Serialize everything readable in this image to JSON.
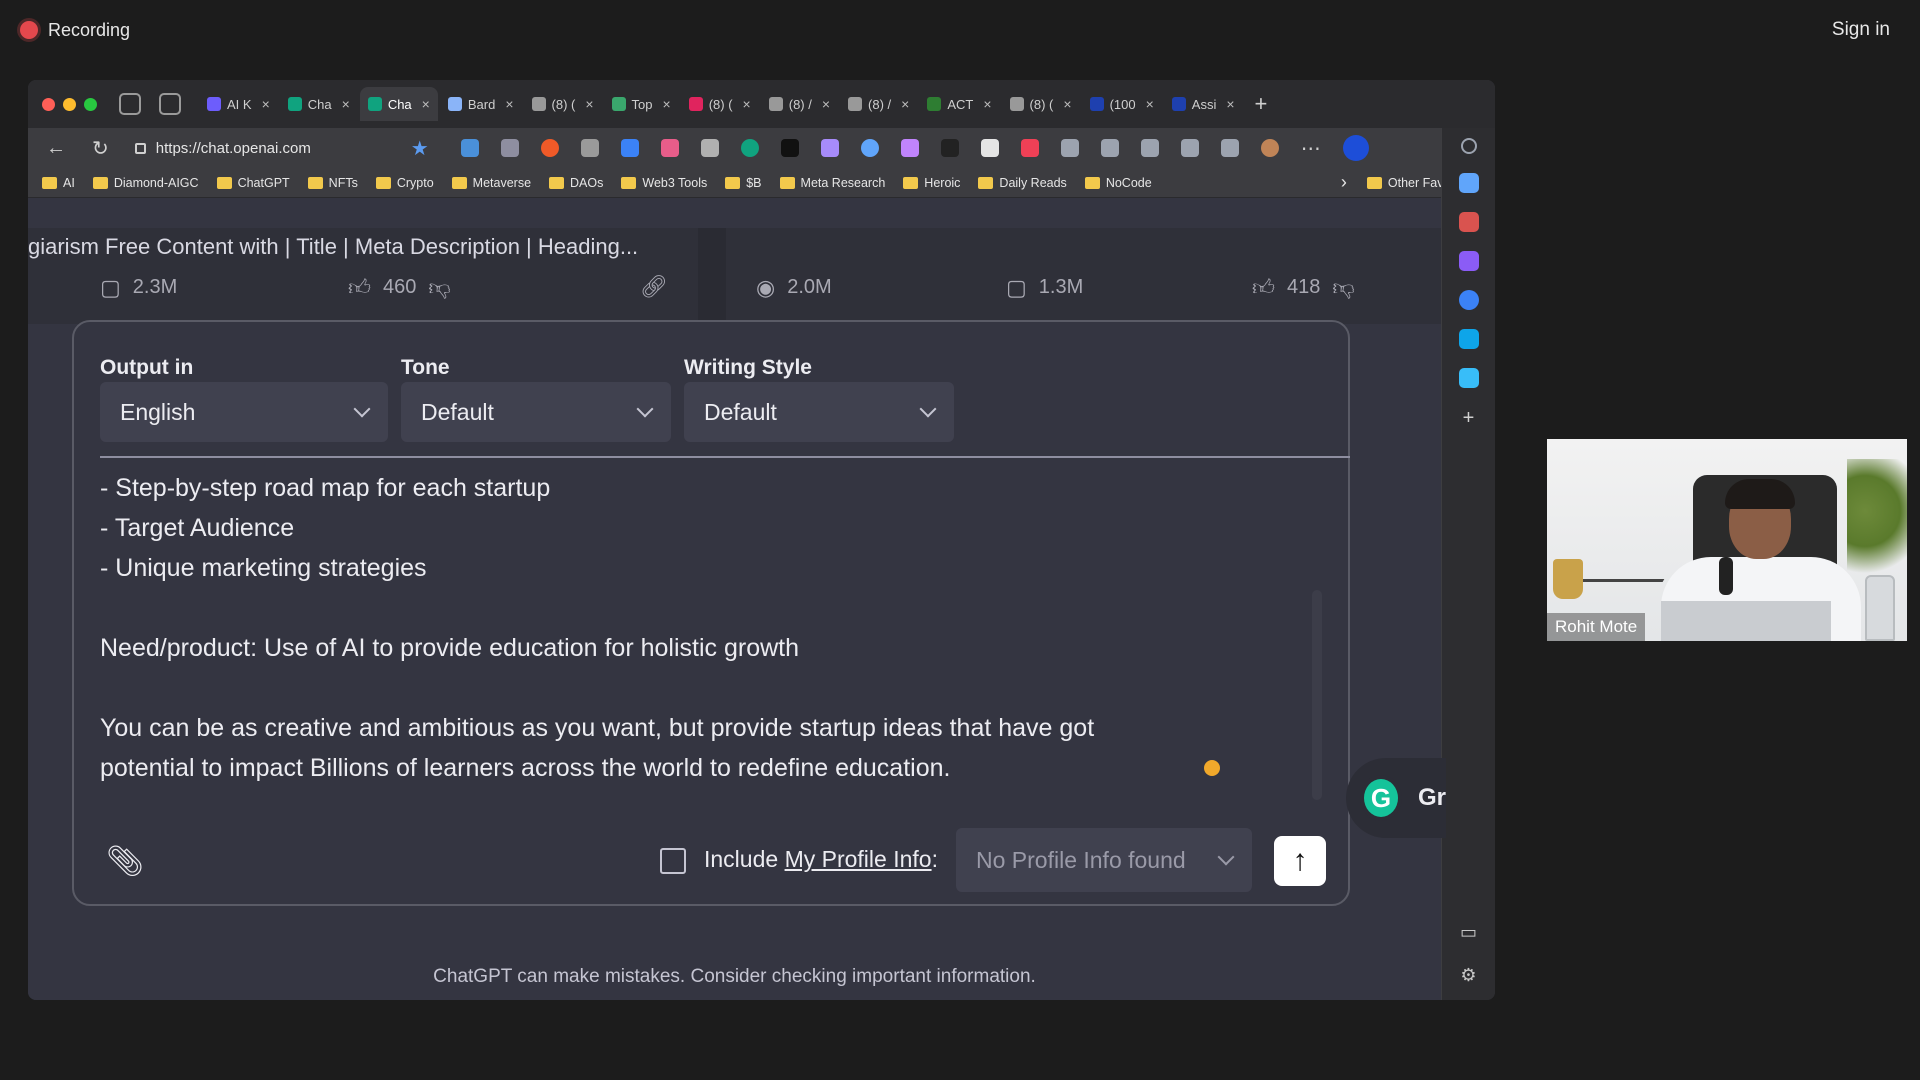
{
  "meeting": {
    "recording_label": "Recording",
    "sign_in": "Sign in",
    "participant_name": "Rohit Mote"
  },
  "browser": {
    "tabs": [
      {
        "label": "AI K",
        "active": false
      },
      {
        "label": "Cha",
        "active": false
      },
      {
        "label": "Cha",
        "active": true
      },
      {
        "label": "Bard",
        "active": false
      },
      {
        "label": "(8) (",
        "active": false
      },
      {
        "label": "Top",
        "active": false
      },
      {
        "label": "(8) (",
        "active": false
      },
      {
        "label": "(8) /",
        "active": false
      },
      {
        "label": "(8) /",
        "active": false
      },
      {
        "label": "ACT",
        "active": false
      },
      {
        "label": "(8) (",
        "active": false
      },
      {
        "label": "(100",
        "active": false
      },
      {
        "label": "Assi",
        "active": false
      }
    ],
    "url": "https://chat.openai.com",
    "bookmarks": [
      "AI",
      "Diamond-AIGC",
      "ChatGPT",
      "NFTs",
      "Crypto",
      "Metaverse",
      "DAOs",
      "Web3 Tools",
      "$B",
      "Meta Research",
      "Heroic",
      "Daily Reads",
      "NoCode"
    ],
    "other_favourites": "Other Favourites"
  },
  "strip": {
    "title": "giarism Free Content with | Title | Meta Description | Heading...",
    "left": {
      "comments": "2.3M",
      "likes": "460"
    },
    "right": {
      "views": "2.0M",
      "comments": "1.3M",
      "likes": "418"
    }
  },
  "composer": {
    "output_label": "Output in",
    "output_value": "English",
    "tone_label": "Tone",
    "tone_value": "Default",
    "style_label": "Writing Style",
    "style_value": "Default",
    "lines": [
      "- Step-by-step road map for each startup",
      "- Target Audience",
      "- Unique marketing strategies",
      "",
      "Need/product: Use of AI to provide education for holistic growth",
      "",
      "You can be as creative and ambitious as you want, but provide startup ideas that have got",
      "potential to impact Billions of learners across the world to redefine education."
    ],
    "include_prefix": "Include ",
    "include_link": "My Profile Info",
    "include_suffix": ":",
    "profile_value": "No Profile Info found"
  },
  "grammarly_text": "Gr",
  "footer_note": "ChatGPT can make mistakes. Consider checking important information.",
  "colors": {
    "background": "#1c1c1c",
    "chat_bg": "#343541",
    "select_bg": "#40414f",
    "record_red": "#e5484d",
    "grammarly_green": "#15c39a"
  }
}
